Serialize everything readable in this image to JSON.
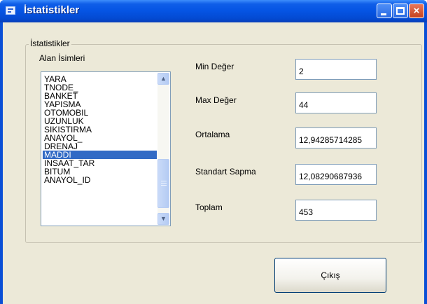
{
  "window": {
    "title": "İstatistikler",
    "controls": {
      "minimize": "minimize",
      "maximize": "maximize",
      "close": "×"
    }
  },
  "group": {
    "title": "İstatistikler",
    "field_label": "Alan İsimleri",
    "fields": [
      "YARA",
      "TNODE_",
      "BANKET",
      "YAPISMA",
      "OTOMOBIL",
      "UZUNLUK",
      "SIKISTIRMA",
      "ANAYOL_",
      "DRENAJ",
      "MADDI",
      "INSAAT_TAR",
      "BITUM",
      "ANAYOL_ID"
    ],
    "selected_field": "MADDI"
  },
  "stats": {
    "min": {
      "label": "Min Değer",
      "value": "2"
    },
    "max": {
      "label": "Max Değer",
      "value": "44"
    },
    "mean": {
      "label": "Ortalama",
      "value": "12,94285714285"
    },
    "stddev": {
      "label": "Standart Sapma",
      "value": "12,08290687936"
    },
    "total": {
      "label": "Toplam",
      "value": "453"
    }
  },
  "buttons": {
    "exit": "Çıkış"
  },
  "scrollbar": {
    "up": "▲",
    "down": "▼"
  },
  "colors": {
    "title_bar": "#0554e3",
    "selection": "#316ac5",
    "face": "#ece9d8"
  }
}
